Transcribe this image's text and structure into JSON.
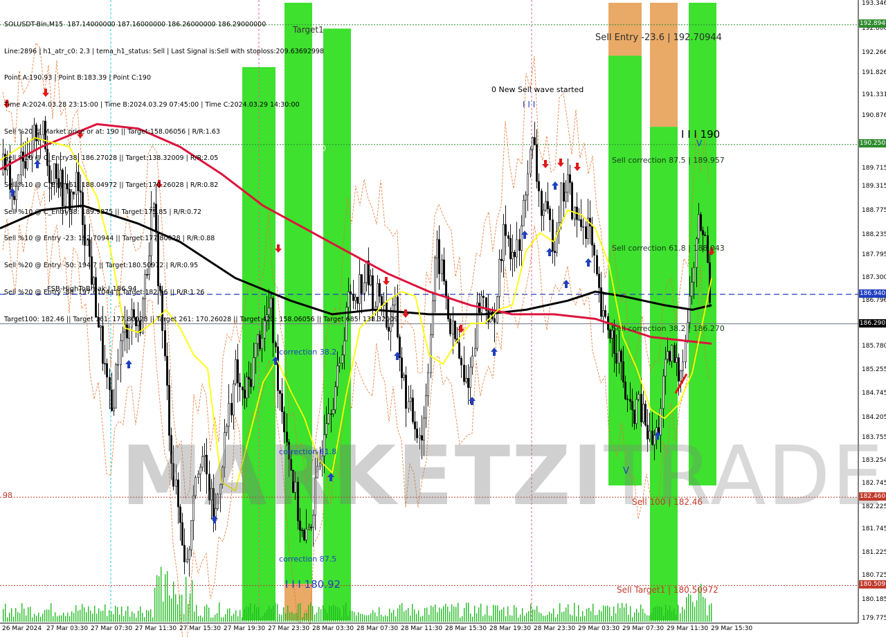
{
  "header_lines": [
    "SOLUSDT-Bin,M15  187.14000000 187.16000000 186.26000000 186.29000000",
    "Line:2896 | h1_atr_c0: 2.3 | tema_h1_status: Sell | Last Signal is:Sell with stoploss:209.63692998",
    "Point A:190.93 | Point B:183.39 | Point C:190",
    "Time A:2024.03.28 23:15:00 | Time B:2024.03.29 07:45:00 | Time C:2024.03.29 14:30:00",
    "Sell %20 @ Market price or at: 190 || Target:158.06056 | R/R:1.63",
    "Sell %10 @ C_Entry38: 186.27028 || Target:138.32009 | R/R:2.05",
    "Sell %10 @ C_Entry61: 188.04972 || Target:170.26028 | R/R:0.82",
    "Sell %10 @ C_Entry88: 189.9875 || Target:175.85 | R/R:0.72",
    "Sell %10 @ Entry -23: 192.70944 || Target:177.80028 | R/R:0.88",
    "Sell %20 @ Entry -50: 194.7 || Target:180.50972 | R/R:0.95",
    "Sell %20 @ Entry -88: 197.61044 || Target:182.46 || R/R:1.26",
    "Target100: 182.46 || Target 161: 177.80028 || Target 261: 170.26028 || Target 423: 158.06056 || Target 685: 138.32009"
  ],
  "watermark": {
    "bold": "MARKETZI",
    "light": "TRADE"
  },
  "chart_labels": {
    "target1": "Target1",
    "hundred": "100",
    "new_wave": "0 New Sell wave started",
    "sell_entry": "Sell Entry -23.6 | 192.70944",
    "sell_corr_875": "Sell correction 87.5 | 189.957",
    "sell_corr_618": "Sell correction 61.8 | 188.043",
    "sell_corr_382": "Sell correction 38.2 | 186.270",
    "sell_100": "Sell 100 | 182.46",
    "sell_target1": "Sell Target1 | 180.50972",
    "fsb": "FSB-HighToBreak | 186.94",
    "corr_382": "correction 38.2",
    "corr_618": "correction 61.8",
    "corr_875": "correction 87.5",
    "iii_180": "I I I 180.92",
    "iii_190": "I I I 190",
    "iii_top": "I I I",
    "left_98": "98",
    "v_mark": "V"
  },
  "price_tags": [
    {
      "value": "192.894",
      "color": "#2e8b2e"
    },
    {
      "value": "190.250",
      "color": "#2e8b2e"
    },
    {
      "value": "186.940",
      "color": "#1f3fc0"
    },
    {
      "value": "186.290",
      "color": "#000000"
    },
    {
      "value": "182.460",
      "color": "#c0392b"
    },
    {
      "value": "180.509",
      "color": "#c0392b"
    }
  ],
  "chart_data": {
    "type": "candlestick",
    "symbol": "SOLUSDT-Bin",
    "timeframe": "M15",
    "y_ticks": [
      "193.346",
      "192.806",
      "192.266",
      "191.826",
      "191.331",
      "190.876",
      "190.250",
      "189.715",
      "189.315",
      "188.775",
      "188.235",
      "187.795",
      "187.300",
      "186.796",
      "186.290",
      "185.780",
      "185.255",
      "184.745",
      "184.205",
      "183.755",
      "183.254",
      "182.745",
      "182.225",
      "181.745",
      "181.225",
      "180.725",
      "180.185",
      "179.775"
    ],
    "ylim": [
      179.74,
      193.38
    ],
    "x_ticks": [
      "26 Mar 2024",
      "27 Mar 03:30",
      "27 Mar 07:30",
      "27 Mar 11:30",
      "27 Mar 15:30",
      "27 Mar 19:30",
      "27 Mar 23:30",
      "28 Mar 03:30",
      "28 Mar 07:30",
      "28 Mar 11:30",
      "28 Mar 15:30",
      "28 Mar 19:30",
      "28 Mar 23:30",
      "29 Mar 03:30",
      "29 Mar 07:30",
      "29 Mar 11:30",
      "29 Mar 15:30"
    ],
    "levels": {
      "fsb_high_to_break": 186.94,
      "current": 186.29,
      "sell_target1": 180.50972,
      "sell_100": 182.46,
      "upper_dotted": 192.894,
      "mid_dotted": 190.25
    },
    "point_a": 190.93,
    "point_b": 183.39,
    "point_c": 190,
    "last_ohlc": {
      "open": 187.14,
      "high": 187.16,
      "low": 186.26,
      "close": 186.29
    },
    "close_path": [
      [
        0,
        189.6
      ],
      [
        10,
        189.9
      ],
      [
        20,
        189.0
      ],
      [
        30,
        190.3
      ],
      [
        40,
        189.6
      ],
      [
        50,
        190.5
      ],
      [
        60,
        190.6
      ],
      [
        70,
        189.6
      ],
      [
        80,
        189.8
      ],
      [
        90,
        189.2
      ],
      [
        100,
        189.0
      ],
      [
        110,
        189.4
      ],
      [
        120,
        188.6
      ],
      [
        130,
        187.6
      ],
      [
        140,
        186.5
      ],
      [
        150,
        185.4
      ],
      [
        160,
        184.2
      ],
      [
        170,
        185.6
      ],
      [
        180,
        186.1
      ],
      [
        190,
        186.6
      ],
      [
        200,
        186.1
      ],
      [
        210,
        187.3
      ],
      [
        220,
        188.9
      ],
      [
        230,
        187.1
      ],
      [
        240,
        184.9
      ],
      [
        250,
        182.9
      ],
      [
        260,
        181.9
      ],
      [
        270,
        180.9
      ],
      [
        280,
        182.9
      ],
      [
        290,
        183.5
      ],
      [
        300,
        182.7
      ],
      [
        310,
        181.9
      ],
      [
        320,
        183.3
      ],
      [
        330,
        184.3
      ],
      [
        340,
        185.2
      ],
      [
        350,
        184.6
      ],
      [
        360,
        185.0
      ],
      [
        370,
        185.8
      ],
      [
        380,
        186.2
      ],
      [
        390,
        186.7
      ],
      [
        400,
        185.2
      ],
      [
        410,
        184.2
      ],
      [
        420,
        183.1
      ],
      [
        430,
        182.1
      ],
      [
        440,
        181.3
      ],
      [
        450,
        182.1
      ],
      [
        460,
        183.0
      ],
      [
        470,
        184.4
      ],
      [
        480,
        184.7
      ],
      [
        490,
        185.2
      ],
      [
        500,
        186.7
      ],
      [
        510,
        186.9
      ],
      [
        520,
        187.2
      ],
      [
        530,
        187.4
      ],
      [
        540,
        186.8
      ],
      [
        550,
        187.0
      ],
      [
        560,
        186.2
      ],
      [
        570,
        186.6
      ],
      [
        580,
        185.2
      ],
      [
        590,
        184.4
      ],
      [
        600,
        184.1
      ],
      [
        610,
        183.8
      ],
      [
        620,
        185.8
      ],
      [
        630,
        187.9
      ],
      [
        640,
        187.3
      ],
      [
        650,
        186.2
      ],
      [
        660,
        185.8
      ],
      [
        670,
        184.9
      ],
      [
        680,
        185.3
      ],
      [
        690,
        186.7
      ],
      [
        700,
        186.9
      ],
      [
        710,
        186.1
      ],
      [
        720,
        187.3
      ],
      [
        730,
        188.5
      ],
      [
        740,
        187.8
      ],
      [
        750,
        187.9
      ],
      [
        760,
        189.5
      ],
      [
        770,
        190.3
      ],
      [
        780,
        188.9
      ],
      [
        790,
        188.6
      ],
      [
        800,
        188.1
      ],
      [
        810,
        189.1
      ],
      [
        820,
        189.4
      ],
      [
        830,
        188.6
      ],
      [
        840,
        188.5
      ],
      [
        850,
        188.5
      ],
      [
        860,
        187.3
      ],
      [
        870,
        186.3
      ],
      [
        880,
        186.2
      ],
      [
        890,
        185.8
      ],
      [
        900,
        185.0
      ],
      [
        910,
        184.2
      ],
      [
        920,
        184.5
      ],
      [
        930,
        184.2
      ],
      [
        940,
        183.6
      ],
      [
        950,
        183.9
      ],
      [
        960,
        185.2
      ],
      [
        970,
        185.6
      ],
      [
        980,
        185.2
      ],
      [
        990,
        186.0
      ],
      [
        1000,
        187.3
      ],
      [
        1010,
        188.6
      ],
      [
        1020,
        188.0
      ],
      [
        1028,
        186.29
      ]
    ],
    "series": [
      {
        "name": "black_ma",
        "color": "#000000",
        "points": [
          [
            0,
            188.4
          ],
          [
            60,
            188.8
          ],
          [
            120,
            188.9
          ],
          [
            200,
            188.5
          ],
          [
            260,
            188.1
          ],
          [
            340,
            187.3
          ],
          [
            420,
            186.8
          ],
          [
            480,
            186.5
          ],
          [
            540,
            186.6
          ],
          [
            620,
            186.5
          ],
          [
            700,
            186.5
          ],
          [
            760,
            186.6
          ],
          [
            820,
            186.8
          ],
          [
            860,
            187.0
          ],
          [
            900,
            186.9
          ],
          [
            960,
            186.7
          ],
          [
            1000,
            186.6
          ],
          [
            1028,
            186.7
          ]
        ]
      },
      {
        "name": "red_ma",
        "color": "#dc143c",
        "points": [
          [
            0,
            189.7
          ],
          [
            60,
            190.2
          ],
          [
            140,
            190.7
          ],
          [
            200,
            190.6
          ],
          [
            260,
            190.2
          ],
          [
            320,
            189.6
          ],
          [
            380,
            188.9
          ],
          [
            440,
            188.4
          ],
          [
            500,
            187.9
          ],
          [
            560,
            187.4
          ],
          [
            620,
            187.0
          ],
          [
            680,
            186.7
          ],
          [
            740,
            186.5
          ],
          [
            800,
            186.5
          ],
          [
            860,
            186.4
          ],
          [
            900,
            186.2
          ],
          [
            940,
            186.0
          ],
          [
            1000,
            185.9
          ],
          [
            1028,
            185.85
          ]
        ]
      },
      {
        "name": "yellow_ma",
        "color": "#ffff00",
        "points": [
          [
            0,
            189.9
          ],
          [
            50,
            190.4
          ],
          [
            100,
            190.2
          ],
          [
            140,
            189.1
          ],
          [
            160,
            187.9
          ],
          [
            180,
            186.2
          ],
          [
            200,
            186.1
          ],
          [
            220,
            186.3
          ],
          [
            240,
            186.6
          ],
          [
            260,
            186.2
          ],
          [
            280,
            185.6
          ],
          [
            300,
            185.3
          ],
          [
            320,
            182.8
          ],
          [
            340,
            182.6
          ],
          [
            360,
            183.8
          ],
          [
            380,
            185.0
          ],
          [
            400,
            185.5
          ],
          [
            420,
            184.8
          ],
          [
            440,
            184.2
          ],
          [
            460,
            183.3
          ],
          [
            480,
            183.0
          ],
          [
            500,
            184.7
          ],
          [
            520,
            186.2
          ],
          [
            540,
            186.5
          ],
          [
            560,
            186.8
          ],
          [
            580,
            187.0
          ],
          [
            600,
            186.9
          ],
          [
            620,
            185.6
          ],
          [
            640,
            185.4
          ],
          [
            660,
            185.9
          ],
          [
            680,
            186.3
          ],
          [
            700,
            186.3
          ],
          [
            720,
            186.6
          ],
          [
            740,
            186.7
          ],
          [
            760,
            187.9
          ],
          [
            780,
            188.3
          ],
          [
            800,
            188.1
          ],
          [
            820,
            188.8
          ],
          [
            840,
            188.7
          ],
          [
            860,
            188.4
          ],
          [
            880,
            187.6
          ],
          [
            900,
            186.0
          ],
          [
            920,
            185.3
          ],
          [
            940,
            184.4
          ],
          [
            960,
            184.2
          ],
          [
            980,
            184.5
          ],
          [
            1000,
            185.2
          ],
          [
            1028,
            187.3
          ]
        ]
      }
    ],
    "zones": [
      {
        "x1": 350,
        "x2": 398,
        "top": 191.96,
        "bottom": 179.74,
        "color": "#22dd11"
      },
      {
        "x1": 411,
        "x2": 451,
        "top": 193.38,
        "bottom": 180.55,
        "color": "#22dd11"
      },
      {
        "x1": 411,
        "x2": 451,
        "top": 180.55,
        "bottom": 179.74,
        "color": "#e59a4c"
      },
      {
        "x1": 467,
        "x2": 507,
        "top": 192.81,
        "bottom": 179.74,
        "color": "#22dd11"
      },
      {
        "x1": 879,
        "x2": 927,
        "top": 193.38,
        "bottom": 192.21,
        "color": "#e59a4c"
      },
      {
        "x1": 879,
        "x2": 927,
        "top": 192.21,
        "bottom": 182.72,
        "color": "#22dd11"
      },
      {
        "x1": 939,
        "x2": 979,
        "top": 193.38,
        "bottom": 190.64,
        "color": "#e59a4c"
      },
      {
        "x1": 939,
        "x2": 979,
        "top": 190.64,
        "bottom": 179.74,
        "color": "#22dd11"
      },
      {
        "x1": 995,
        "x2": 1035,
        "top": 193.38,
        "bottom": 182.72,
        "color": "#22dd11"
      }
    ]
  }
}
